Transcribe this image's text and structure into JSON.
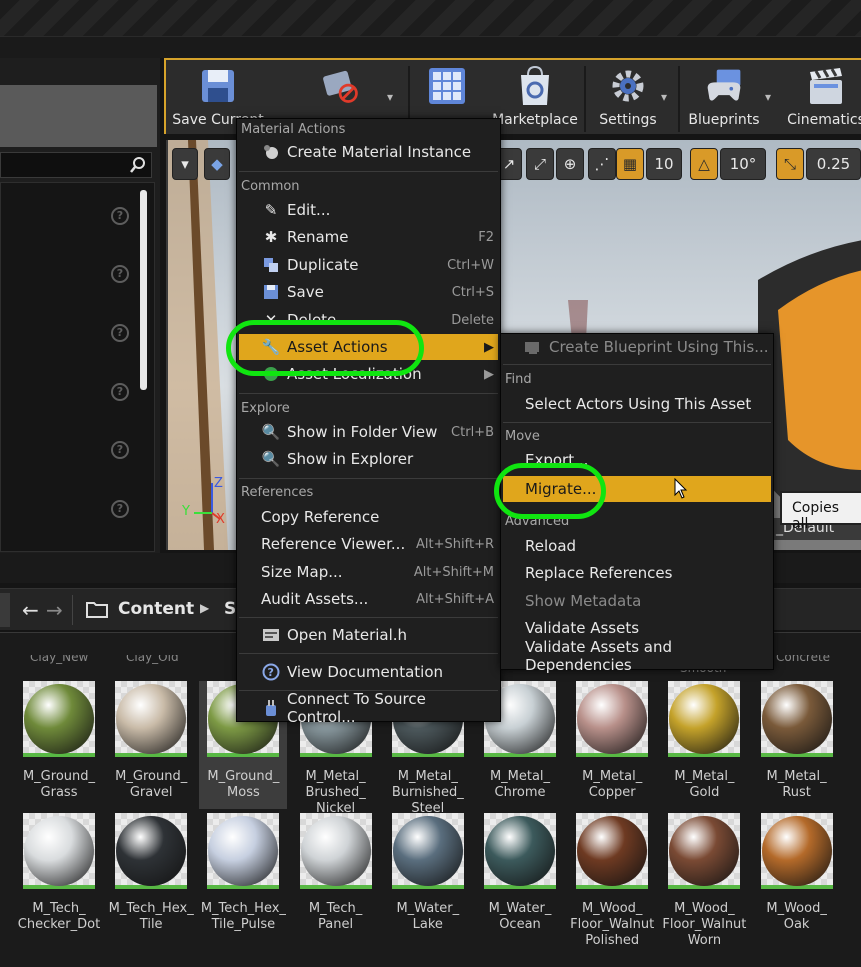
{
  "toolbar": {
    "buttons": [
      {
        "label": "Save Current"
      },
      {
        "label": "Source Control"
      },
      {
        "label": "Content"
      },
      {
        "label": "Marketplace"
      },
      {
        "label": "Settings"
      },
      {
        "label": "Blueprints"
      },
      {
        "label": "Cinematics"
      }
    ]
  },
  "viewport": {
    "grid_snap": "10",
    "rotation_snap": "10°",
    "scale_snap": "0.25",
    "label_partial": "_Default"
  },
  "path": {
    "root": "Content",
    "next": "S"
  },
  "context_menu": {
    "sections": {
      "material_actions": "Material Actions",
      "common": "Common",
      "explore": "Explore",
      "references": "References"
    },
    "items": {
      "create_material_instance": "Create Material Instance",
      "edit": "Edit...",
      "rename": "Rename",
      "rename_sc": "F2",
      "duplicate": "Duplicate",
      "duplicate_sc": "Ctrl+W",
      "save": "Save",
      "save_sc": "Ctrl+S",
      "delete": "Delete",
      "delete_sc": "Delete",
      "asset_actions": "Asset Actions",
      "asset_localization": "Asset Localization",
      "show_in_folder": "Show in Folder View",
      "show_in_folder_sc": "Ctrl+B",
      "show_in_explorer": "Show in Explorer",
      "copy_reference": "Copy Reference",
      "reference_viewer": "Reference Viewer...",
      "reference_viewer_sc": "Alt+Shift+R",
      "size_map": "Size Map...",
      "size_map_sc": "Alt+Shift+M",
      "audit_assets": "Audit Assets...",
      "audit_assets_sc": "Alt+Shift+A",
      "open_material_h": "Open Material.h",
      "view_documentation": "View Documentation",
      "connect_source_control": "Connect To Source Control..."
    }
  },
  "submenu": {
    "create_blueprint": "Create Blueprint Using This...",
    "find": "Find",
    "select_actors": "Select Actors Using This Asset",
    "move": "Move",
    "export": "Export...",
    "migrate": "Migrate...",
    "advanced": "Advanced",
    "reload": "Reload",
    "replace_references": "Replace References",
    "show_metadata": "Show Metadata",
    "validate_assets": "Validate Assets",
    "validate_assets_deps": "Validate Assets and Dependencies"
  },
  "tooltip": "Copies all",
  "assets_row1": [
    {
      "label": "M_Ground_\nGrass",
      "color": "#6f8a3a"
    },
    {
      "label": "M_Ground_\nGravel",
      "color": "#c9bba8"
    },
    {
      "label": "M_Ground_\nMoss",
      "color": "#7d9a45"
    },
    {
      "label": "M_Metal_\nBrushed_\nNickel",
      "color": "#8a9aa0"
    },
    {
      "label": "M_Metal_\nBurnished_\nSteel",
      "color": "#4e5a5e"
    },
    {
      "label": "M_Metal_\nChrome",
      "color": "#c8d0d4"
    },
    {
      "label": "M_Metal_\nCopper",
      "color": "#b8908a"
    },
    {
      "label": "M_Metal_\nGold",
      "color": "#c4a22a"
    },
    {
      "label": "M_Metal_\nRust",
      "color": "#7a5a3a"
    }
  ],
  "assets_row2": [
    {
      "label": "M_Tech_\nChecker_Dot",
      "color": "#d9dcde"
    },
    {
      "label": "M_Tech_Hex_\nTile",
      "color": "#2e3236"
    },
    {
      "label": "M_Tech_Hex_\nTile_Pulse",
      "color": "#c6cfe0"
    },
    {
      "label": "M_Tech_\nPanel",
      "color": "#cfd3d6"
    },
    {
      "label": "M_Water_\nLake",
      "color": "#5a6e7e"
    },
    {
      "label": "M_Water_\nOcean",
      "color": "#3c5a5c"
    },
    {
      "label": "M_Wood_\nFloor_Walnut\nPolished",
      "color": "#6e3a22"
    },
    {
      "label": "M_Wood_\nFloor_Walnut\nWorn",
      "color": "#7a4a34"
    },
    {
      "label": "M_Wood_\nOak",
      "color": "#b46a2a"
    }
  ],
  "assets_row0_partial": [
    "Clay_New",
    "Clay_Old",
    "Smooth",
    "Concrete"
  ]
}
